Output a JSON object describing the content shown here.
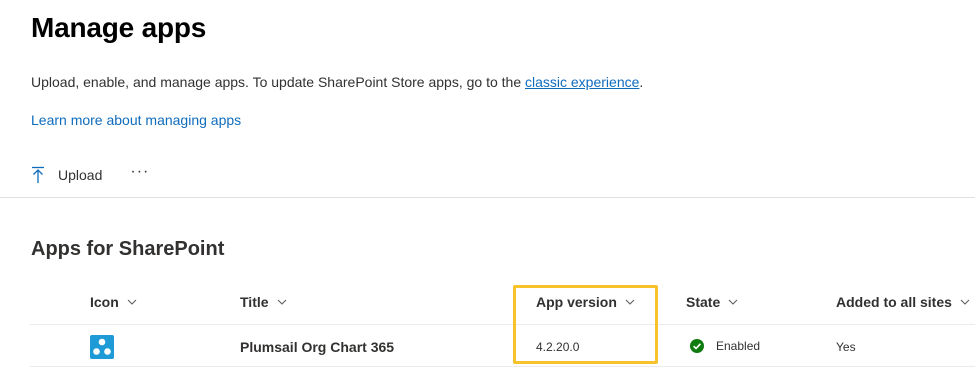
{
  "page": {
    "title": "Manage apps",
    "description_prefix": "Upload, enable, and manage apps. To update SharePoint Store apps, go to the ",
    "description_link": "classic experience",
    "description_suffix": ".",
    "learn_more": "Learn more about managing apps"
  },
  "toolbar": {
    "upload_label": "Upload",
    "upload_icon": "upload-arrow-icon",
    "more_label": "···"
  },
  "section": {
    "title": "Apps for SharePoint"
  },
  "table": {
    "columns": [
      "Icon",
      "Title",
      "App version",
      "State",
      "Added to all sites"
    ],
    "rows": [
      {
        "icon": "plumsail-org-chart-icon",
        "title": "Plumsail Org Chart 365",
        "app_version": "4.2.20.0",
        "state": "Enabled",
        "state_icon": "check-circle-icon",
        "added_to_all_sites": "Yes"
      }
    ]
  },
  "colors": {
    "link": "#0f6cbd",
    "highlight": "#f7c22a",
    "enabled": "#107c10",
    "app_icon_bg": "#1e9bd7"
  }
}
